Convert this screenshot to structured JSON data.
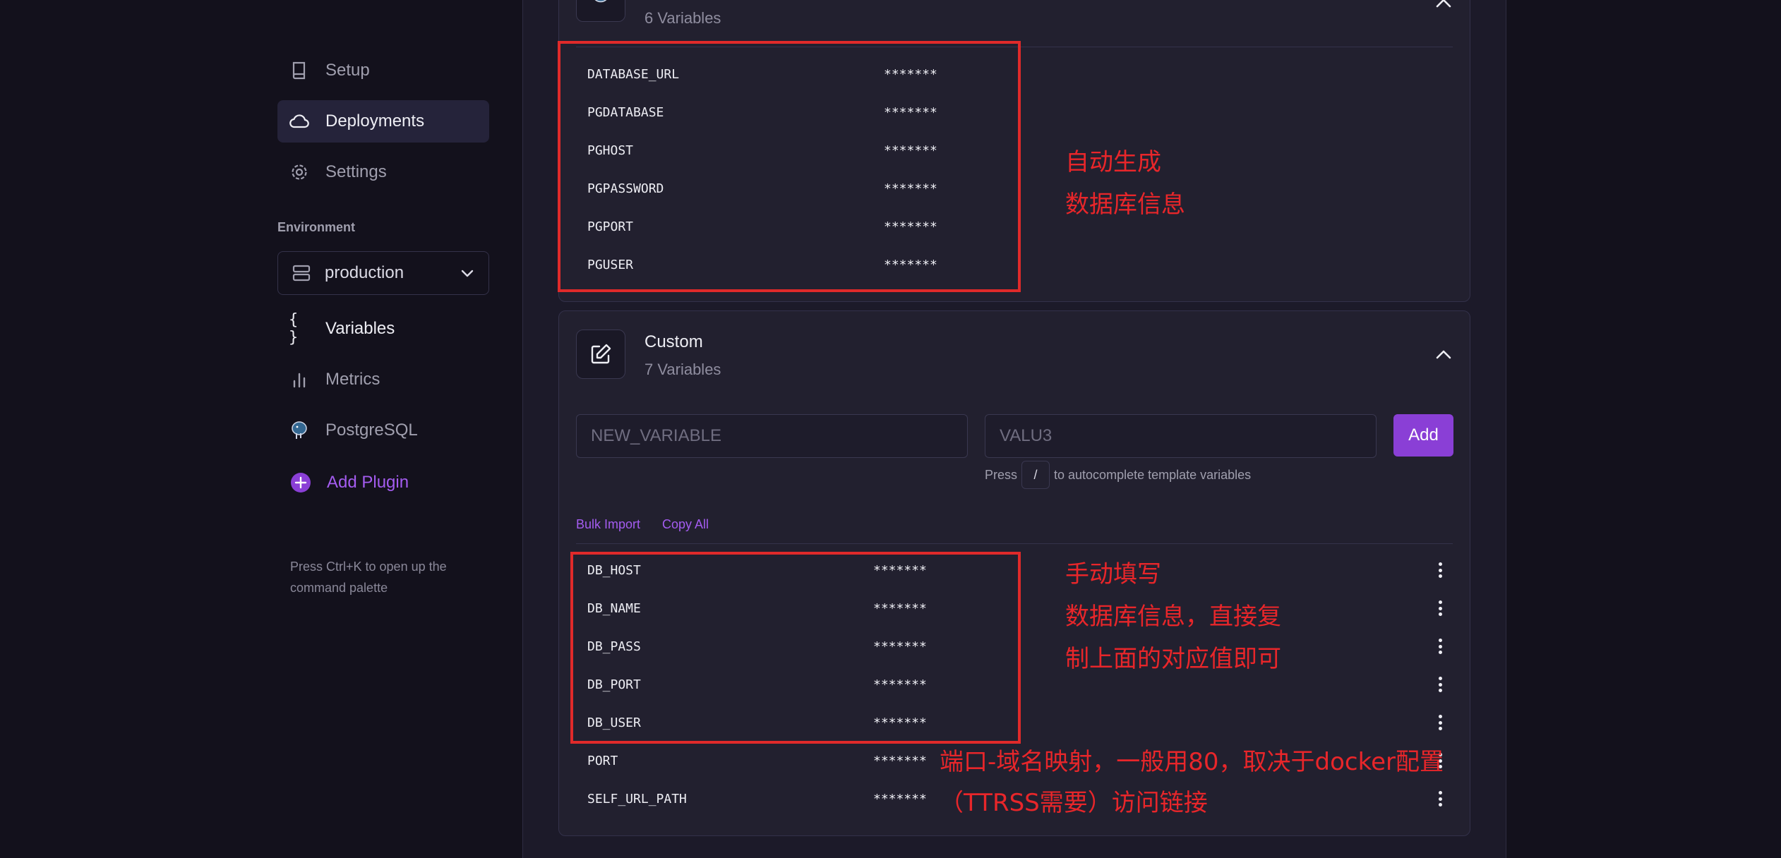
{
  "sidebar": {
    "items": [
      {
        "label": "Setup",
        "icon": "book-icon"
      },
      {
        "label": "Deployments",
        "icon": "cloud-icon"
      },
      {
        "label": "Settings",
        "icon": "gear-icon"
      }
    ],
    "environment_label": "Environment",
    "environment_value": "production",
    "project_items": [
      {
        "label": "Variables",
        "icon": "braces-icon"
      },
      {
        "label": "Metrics",
        "icon": "bar-chart-icon"
      },
      {
        "label": "PostgreSQL",
        "icon": "postgres-elephant-icon"
      }
    ],
    "add_plugin": "Add Plugin",
    "palette_hint": "Press Ctrl+K to open up the command palette"
  },
  "postgres_card": {
    "subtitle": "6 Variables",
    "variables": [
      {
        "name": "DATABASE_URL",
        "value": "*******"
      },
      {
        "name": "PGDATABASE",
        "value": "*******"
      },
      {
        "name": "PGHOST",
        "value": "*******"
      },
      {
        "name": "PGPASSWORD",
        "value": "*******"
      },
      {
        "name": "PGPORT",
        "value": "*******"
      },
      {
        "name": "PGUSER",
        "value": "*******"
      }
    ]
  },
  "custom_card": {
    "title": "Custom",
    "subtitle": "7 Variables",
    "name_placeholder": "NEW_VARIABLE",
    "value_placeholder": "VALU3",
    "add_label": "Add",
    "hint_before": "Press",
    "hint_key": "/",
    "hint_after": "to autocomplete template variables",
    "bulk_import": "Bulk Import",
    "copy_all": "Copy All",
    "variables": [
      {
        "name": "DB_HOST",
        "value": "*******"
      },
      {
        "name": "DB_NAME",
        "value": "*******"
      },
      {
        "name": "DB_PASS",
        "value": "*******"
      },
      {
        "name": "DB_PORT",
        "value": "*******"
      },
      {
        "name": "DB_USER",
        "value": "*******"
      },
      {
        "name": "PORT",
        "value": "*******"
      },
      {
        "name": "SELF_URL_PATH",
        "value": "*******"
      }
    ]
  },
  "annotations": {
    "auto": [
      "自动生成",
      "数据库信息"
    ],
    "manual": [
      "手动填写",
      "数据库信息，直接复",
      "制上面的对应值即可"
    ],
    "port": "端口-域名映射，一般用80，取决于docker配置",
    "self_url": "（TTRSS需要）访问链接",
    "color": "#e8262a"
  },
  "colors": {
    "accent": "#8a3fd6",
    "link": "#a45cf0",
    "background": "#13111c"
  }
}
